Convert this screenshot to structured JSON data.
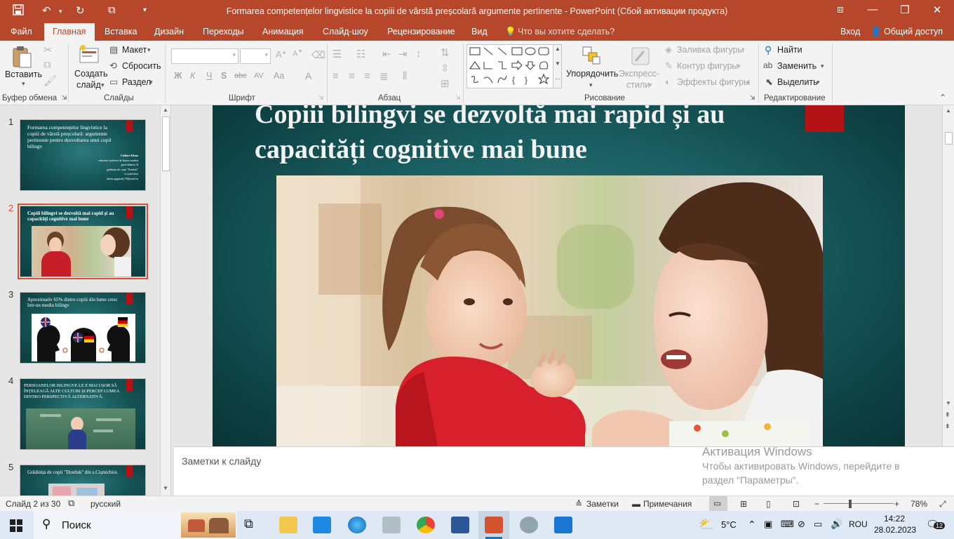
{
  "window": {
    "title": "Formarea competențelor lingvistice la copiii de vârstă preșcolară argumente pertinente - PowerPoint (Сбой активации продукта)"
  },
  "ribbon_tabs": [
    "Файл",
    "Главная",
    "Вставка",
    "Дизайн",
    "Переходы",
    "Анимация",
    "Слайд-шоу",
    "Рецензирование",
    "Вид"
  ],
  "tell_me": "Что вы хотите сделать?",
  "signin": "Вход",
  "share": "Общий доступ",
  "ribbon": {
    "clipboard": {
      "paste": "Вставить",
      "label": "Буфер обмена"
    },
    "slides": {
      "new_slide_1": "Создать",
      "new_slide_2": "слайд",
      "layout": "Макет",
      "reset": "Сбросить",
      "section": "Раздел",
      "label": "Слайды"
    },
    "font": {
      "label": "Шрифт",
      "bold": "Ж",
      "italic": "К",
      "underline": "Ч",
      "shadow": "S",
      "strike": "abc",
      "spacing": "AV",
      "case": "Aa"
    },
    "paragraph": {
      "label": "Абзац"
    },
    "drawing": {
      "arrange_1": "Упорядочить",
      "quick_styles_1": "Экспресс-",
      "quick_styles_2": "стили",
      "fill": "Заливка фигуры",
      "outline": "Контур фигуры",
      "effects": "Эффекты фигуры",
      "label": "Рисование"
    },
    "editing": {
      "find": "Найти",
      "replace": "Заменить",
      "select": "Выделить",
      "label": "Редактирование"
    }
  },
  "thumbnails": [
    {
      "num": "1",
      "title": "Formarea competențelor lingvistice la copiii de vârstă preșcolară: argumente pertinente pentru dezvoltarea unui copil bilingv",
      "details": [
        "Caldari Aliona",
        "educator-profesor de limba română",
        "grad didactic II",
        "grădinița de copii \"Dostluk\"",
        "s.Cișmichioi",
        "aliona.gagauzly.76@mail.ru"
      ]
    },
    {
      "num": "2",
      "title": "Copiii bilingvi se dezvoltă mai rapid și au capacități cognitive mai bune"
    },
    {
      "num": "3",
      "title": "Aproximativ 65% dintre copiii din lume cresc într-un mediu bilingv"
    },
    {
      "num": "4",
      "title": "PERSOANELOR BILINGVE LE E MAI UȘOR SĂ ÎNȚELEAGĂ ALTE CULTURI ȘI PERCEP LUMEA DINTRO PERSPECTIVĂ ALTERNATIVĂ."
    },
    {
      "num": "5",
      "title": "Grădinița de copii \"Dostluk\" din s.Cișmichioi."
    }
  ],
  "slide": {
    "title": "Copiii bilingvi se dezvoltă mai rapid și au capacități cognitive mai bune"
  },
  "notes_placeholder": "Заметки к слайду",
  "activation": {
    "title": "Активация Windows",
    "line1": "Чтобы активировать Windows, перейдите в",
    "line2": "раздел \"Параметры\"."
  },
  "status": {
    "slide_count": "Слайд 2 из 30",
    "language": "русский",
    "notes": "Заметки",
    "comments": "Примечания",
    "zoom": "78%",
    "zoom_fraction": 0.78
  },
  "taskbar": {
    "search": "Поиск",
    "weather": "5°C",
    "lang": "ROU",
    "time": "14:22",
    "date": "28.02.2023",
    "notifications": "12"
  },
  "colors": {
    "accent": "#b7472a",
    "slide_red": "#b31217",
    "selection": "#d35230"
  }
}
